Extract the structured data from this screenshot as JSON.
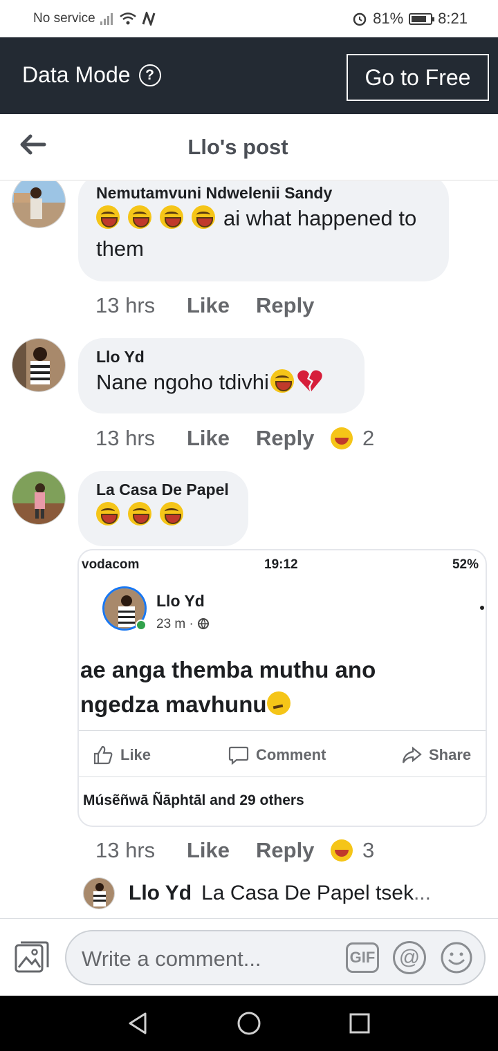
{
  "status_bar": {
    "carrier": "No service",
    "battery": "81%",
    "battery_level": 0.81,
    "time": "8:21"
  },
  "data_mode": {
    "title": "Data Mode",
    "help_icon": "question-circle-icon",
    "go_free_label": "Go to Free"
  },
  "header": {
    "back_icon": "back-arrow-icon",
    "title": "Llo's post"
  },
  "comments": [
    {
      "author": "Nemutamvuni Ndwelenii Sandy",
      "text": "ai what happened to them",
      "emoji_count": 4,
      "time": "13 hrs",
      "like": "Like",
      "reply": "Reply"
    },
    {
      "author": "Llo Yd",
      "text": "Nane ngoho tdivhi",
      "time": "13 hrs",
      "like": "Like",
      "reply": "Reply",
      "reactions": "2"
    },
    {
      "author": "La Casa De Papel",
      "emoji_count": 3,
      "time": "13 hrs",
      "like": "Like",
      "reply": "Reply",
      "reactions": "3"
    }
  ],
  "screenshot": {
    "carrier": "vodacom",
    "time": "19:12",
    "battery": "52%",
    "name": "Llo Yd",
    "posted": "23 m ·",
    "line1": "ae anga themba muthu ano",
    "line2": "ngedza mavhunu",
    "like": "Like",
    "comment": "Comment",
    "share": "Share",
    "likes": "Músẽñwā Ñāphtāl and 29 others"
  },
  "reply_preview": {
    "name": "Llo Yd",
    "text": "La Casa De Papel tsek",
    "ellipsis": "..."
  },
  "composer": {
    "placeholder": "Write a comment...",
    "gif": "GIF",
    "at": "@"
  },
  "colors": {
    "data_bar": "#232a33",
    "bubble": "#f0f2f5",
    "muted": "#65676b"
  }
}
